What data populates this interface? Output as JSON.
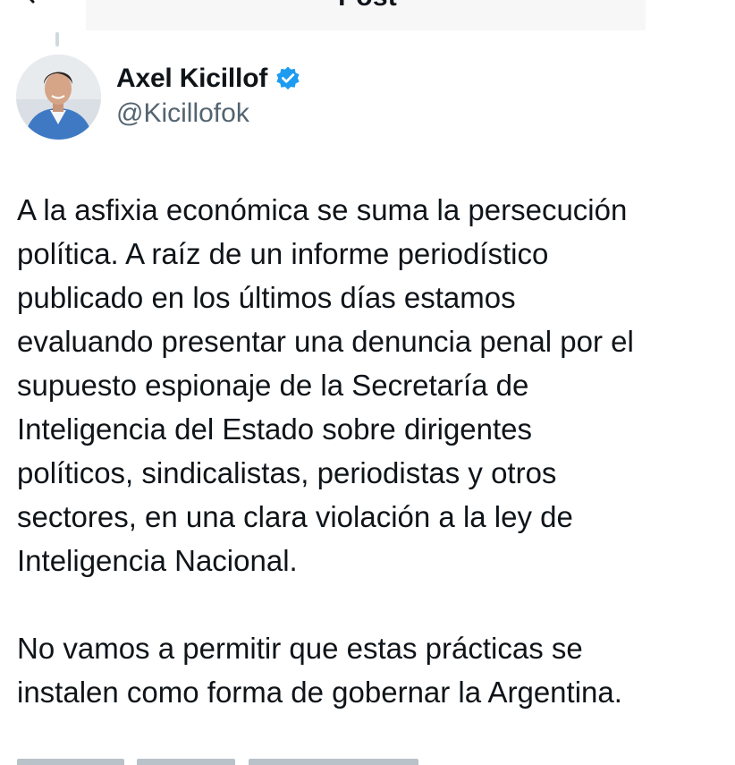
{
  "header": {
    "title": "Post"
  },
  "author": {
    "display_name": "Axel Kicillof",
    "handle": "@Kicillofok",
    "verified": true
  },
  "tweet": {
    "paragraphs": [
      "A la asfixia económica se suma la persecución\npolítica. A raíz de un informe periodístico\npublicado en los últimos días estamos\nevaluando presentar una denuncia penal por el\nsupuesto espionaje de la Secretaría de\nInteligencia del Estado sobre dirigentes\npolíticos, sindicalistas, periodistas y otros\nsectores, en una clara violación a la ley de\nInteligencia Nacional.",
      "No vamos a permitir que estas prácticas se\ninstalen como forma de gobernar la Argentina."
    ]
  },
  "colors": {
    "verified_badge": "#1d9bf0",
    "secondary_text": "#536471",
    "primary_text": "#0f1419"
  },
  "icons": {
    "back": "chevron-left-icon",
    "verified": "verified-badge-icon"
  }
}
